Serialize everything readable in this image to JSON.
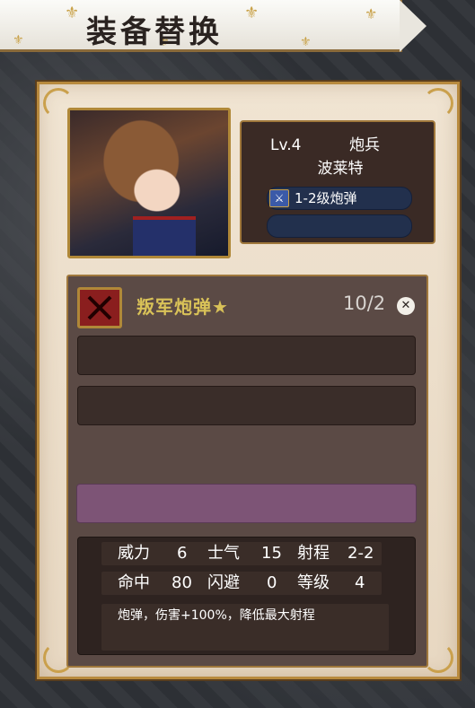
{
  "title": "装备替换",
  "unit": {
    "level": "Lv.4",
    "class": "炮兵",
    "name": "波莱特",
    "equipped_slot_label": "1-2级炮弹",
    "empty_slot_label": ""
  },
  "item": {
    "name": "叛军炮弹★",
    "count": "10/2",
    "close_symbol": "✕"
  },
  "stats": {
    "row1": [
      {
        "label": "威力",
        "value": "6"
      },
      {
        "label": "士气",
        "value": "15"
      },
      {
        "label": "射程",
        "value": "2-2"
      }
    ],
    "row2": [
      {
        "label": "命中",
        "value": "80"
      },
      {
        "label": "闪避",
        "value": "0"
      },
      {
        "label": "等级",
        "value": "4"
      }
    ],
    "description": "炮弹，伤害+100%，降低最大射程"
  },
  "icons": {
    "slot_icon": "sword-icon",
    "item_icon": "crossed-out-icon",
    "close_icon": "close-icon",
    "decoration": "fleur-de-lis-icon"
  },
  "colors": {
    "title_text": "#2a2320",
    "item_name": "#d9c258",
    "purple_slot": "#7d5476",
    "slot_bar": "#22304d"
  }
}
